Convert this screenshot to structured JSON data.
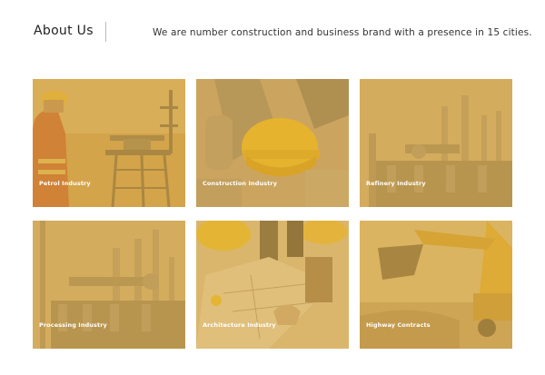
{
  "header": {
    "title": "About Us",
    "tagline": "We are number construction and business brand with a presence in 15 cities."
  },
  "cards": [
    {
      "label": "Petrol Industry",
      "icon": "oil-rig-scene"
    },
    {
      "label": "Construction Industry",
      "icon": "hard-hat-scene"
    },
    {
      "label": "Refinery Industry",
      "icon": "refinery-scene"
    },
    {
      "label": "Processing Industry",
      "icon": "processing-plant-scene"
    },
    {
      "label": "Architecture Industry",
      "icon": "blueprint-scene"
    },
    {
      "label": "Highway Contracts",
      "icon": "excavator-scene"
    }
  ],
  "colors": {
    "overlay": "#dba83e",
    "card_base": "#d4a54a",
    "label_text": "#ffffff",
    "title_text": "#222222"
  }
}
